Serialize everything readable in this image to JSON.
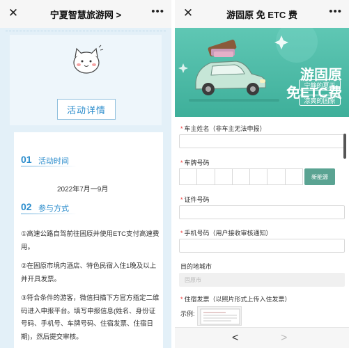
{
  "left": {
    "title": "宁夏智慧旅游网 >",
    "detail_button": "活动详情",
    "sections": [
      {
        "num": "01",
        "label": "活动时间"
      },
      {
        "num": "02",
        "label": "参与方式"
      }
    ],
    "date_range": "2022年7月一9月",
    "paragraphs": [
      "①高速公路自驾前往固原并使用ETC支付高速费用。",
      "②在固原市境内酒店、特色民宿入住1晚及以上并开具发票。",
      "③符合条件的游客，微信扫描下方官方指定二维码进入申报平台。填写申报信息(姓名、身份证号码、手机号、车牌号码、住宿发票、住宿日期)，然后提交审核。"
    ]
  },
  "right": {
    "title": "游固原 免 ETC 费",
    "banner": {
      "headline_line1": "游固原",
      "headline_line2": "免ETC费",
      "pill1": "宁静的夏天",
      "pill2": "凉爽的固原"
    },
    "form": {
      "owner_name_label": "车主姓名（非车主无法申报）",
      "plate_label": "车牌号码",
      "nev_button": "新能源",
      "id_label": "证件号码",
      "phone_label": "手机号码（用户接收审核通知）",
      "city_label": "目的地城市",
      "city_placeholder": "固原市",
      "invoice_label": "住宿发票（以照片形式上传入住发票）",
      "example_label": "示例:"
    },
    "nav": {
      "back": "<",
      "forward": ">"
    }
  },
  "colors": {
    "accent_blue": "#2a8ccc",
    "banner_teal": "#4dbaa5",
    "nev_button": "#5aa392"
  }
}
